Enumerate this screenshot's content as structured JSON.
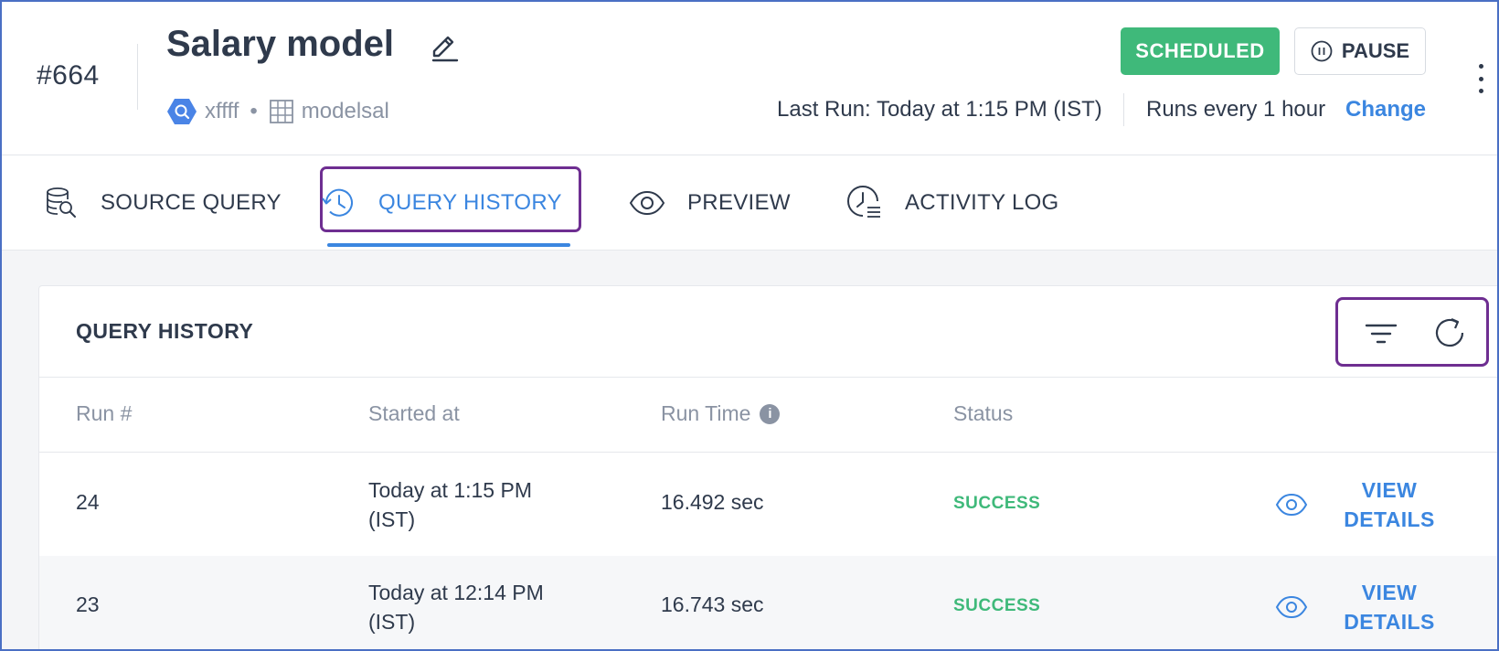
{
  "header": {
    "model_id": "#664",
    "title": "Salary model",
    "source_name": "xffff",
    "separator": "•",
    "table_name": "modelsal",
    "last_run": "Last Run: Today at 1:15 PM (IST)",
    "runs_every": "Runs every 1 hour",
    "change_label": "Change",
    "status_badge": "SCHEDULED",
    "pause_label": "PAUSE"
  },
  "tabs": [
    {
      "label": "SOURCE QUERY",
      "icon": "database-search-icon",
      "active": false
    },
    {
      "label": "QUERY HISTORY",
      "icon": "history-icon",
      "active": true
    },
    {
      "label": "PREVIEW",
      "icon": "eye-icon",
      "active": false
    },
    {
      "label": "ACTIVITY LOG",
      "icon": "clock-list-icon",
      "active": false
    }
  ],
  "query_history": {
    "title": "QUERY HISTORY",
    "columns": [
      "Run #",
      "Started at",
      "Run Time",
      "Status"
    ],
    "rows": [
      {
        "run": "24",
        "started_line1": "Today at 1:15 PM",
        "started_line2": "(IST)",
        "run_time": "16.492 sec",
        "status": "SUCCESS",
        "action_line1": "VIEW",
        "action_line2": "DETAILS"
      },
      {
        "run": "23",
        "started_line1": "Today at 12:14 PM",
        "started_line2": "(IST)",
        "run_time": "16.743 sec",
        "status": "SUCCESS",
        "action_line1": "VIEW",
        "action_line2": "DETAILS"
      }
    ]
  },
  "colors": {
    "accent": "#3b86e0",
    "success": "#3fb97a",
    "highlight": "#6e2e91",
    "text": "#2f3a4c",
    "muted": "#8a93a3"
  }
}
